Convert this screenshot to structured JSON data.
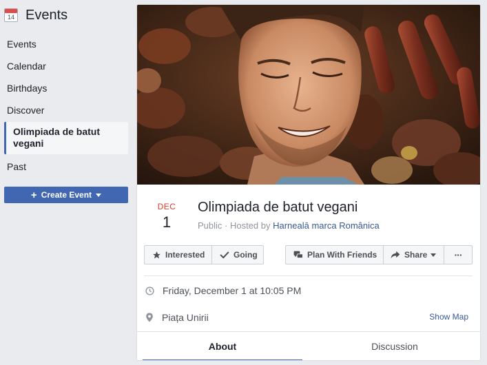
{
  "sidebar": {
    "title": "Events",
    "calendar_icon_day": "14",
    "items": [
      "Events",
      "Calendar",
      "Birthdays",
      "Discover"
    ],
    "active_item": "Olimpiada de batut vegani",
    "last_item": "Past",
    "create_button": "Create Event"
  },
  "event": {
    "month": "DEC",
    "day": "1",
    "title": "Olimpiada de batut vegani",
    "visibility": "Public · Hosted by ",
    "host": "Harnealā marca Românica",
    "datetime": "Friday, December 1 at 10:05 PM",
    "location": "Piața Unirii",
    "show_map": "Show Map"
  },
  "actions": {
    "interested": "Interested",
    "going": "Going",
    "plan": "Plan With Friends",
    "share": "Share",
    "more": "···"
  },
  "tabs": [
    "About",
    "Discussion"
  ],
  "colors": {
    "accent": "#4267b2",
    "link": "#385898",
    "date_month": "#e0392b",
    "background": "#e9ebee"
  }
}
